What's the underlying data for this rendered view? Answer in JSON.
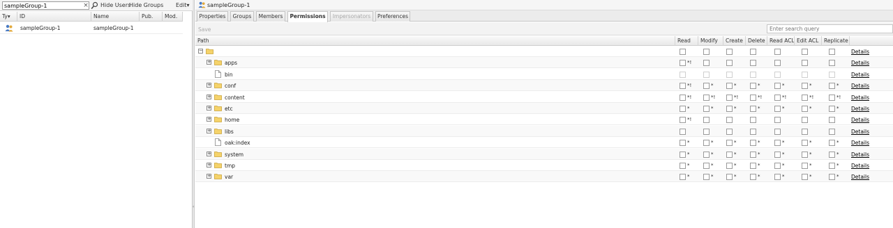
{
  "left_panel": {
    "search_value": "sampleGroup-1",
    "clear_glyph": "×",
    "search_icon": "search-icon",
    "hide_users": "Hide Users",
    "hide_groups": "Hide Groups",
    "edit_menu": "Edit",
    "columns": {
      "type": "Ty",
      "id": "ID",
      "name": "Name",
      "pub": "Pub.",
      "mod": "Mod."
    },
    "row": {
      "icon": "group-icon",
      "id": "sampleGroup-1",
      "name": "sampleGroup-1"
    }
  },
  "right_panel": {
    "title": "sampleGroup-1",
    "tabs": [
      {
        "label": "Properties",
        "state": "normal"
      },
      {
        "label": "Groups",
        "state": "normal"
      },
      {
        "label": "Members",
        "state": "normal"
      },
      {
        "label": "Permissions",
        "state": "active"
      },
      {
        "label": "Impersonators",
        "state": "disabled"
      },
      {
        "label": "Preferences",
        "state": "normal"
      }
    ],
    "save_label": "Save",
    "search_placeholder": "Enter search query",
    "columns": {
      "path": "Path",
      "read": "Read",
      "modify": "Modify",
      "create": "Create",
      "delete": "Delete",
      "read_acl": "Read ACL",
      "edit_acl": "Edit ACL",
      "replicate": "Replicate"
    },
    "details_label": "Details",
    "rows": [
      {
        "name": "",
        "type": "folder",
        "expand": "−",
        "marks": [
          "",
          "",
          "",
          "",
          "",
          "",
          ""
        ],
        "disabled": false
      },
      {
        "name": "apps",
        "type": "folder",
        "expand": "+",
        "marks": [
          "*!",
          "",
          "",
          "",
          "",
          "",
          ""
        ],
        "disabled": false
      },
      {
        "name": "bin",
        "type": "file",
        "expand": "",
        "marks": [
          "",
          "",
          "",
          "",
          "",
          "",
          ""
        ],
        "disabled": true
      },
      {
        "name": "conf",
        "type": "folder",
        "expand": "+",
        "marks": [
          "*!",
          "*",
          "*",
          "*",
          "*",
          "*",
          "*"
        ],
        "disabled": false
      },
      {
        "name": "content",
        "type": "folder",
        "expand": "+",
        "marks": [
          "*!",
          "*!",
          "*!",
          "*!",
          "*!",
          "*!",
          "*!"
        ],
        "disabled": false
      },
      {
        "name": "etc",
        "type": "folder",
        "expand": "+",
        "marks": [
          "*",
          "*",
          "*",
          "*",
          "*",
          "*",
          "*"
        ],
        "disabled": false
      },
      {
        "name": "home",
        "type": "folder",
        "expand": "+",
        "marks": [
          "*!",
          "",
          "",
          "",
          "",
          "",
          ""
        ],
        "disabled": false
      },
      {
        "name": "libs",
        "type": "folder",
        "expand": "+",
        "marks": [
          "",
          "",
          "",
          "",
          "",
          "",
          ""
        ],
        "disabled": false
      },
      {
        "name": "oak:index",
        "type": "file",
        "expand": "",
        "marks": [
          "*",
          "*",
          "*",
          "*",
          "*",
          "*",
          "*"
        ],
        "disabled": false
      },
      {
        "name": "system",
        "type": "folder",
        "expand": "+",
        "marks": [
          "*",
          "*",
          "*",
          "*",
          "*",
          "*",
          "*"
        ],
        "disabled": false
      },
      {
        "name": "tmp",
        "type": "folder",
        "expand": "+",
        "marks": [
          "*",
          "*",
          "*",
          "*",
          "*",
          "*",
          "*"
        ],
        "disabled": false
      },
      {
        "name": "var",
        "type": "folder",
        "expand": "+",
        "marks": [
          "*",
          "*",
          "*",
          "*",
          "*",
          "*",
          "*"
        ],
        "disabled": false
      }
    ]
  },
  "colors": {
    "folder": "#f5d36b",
    "folder_border": "#c9a33a",
    "group_icon": "#4a7bc4"
  }
}
